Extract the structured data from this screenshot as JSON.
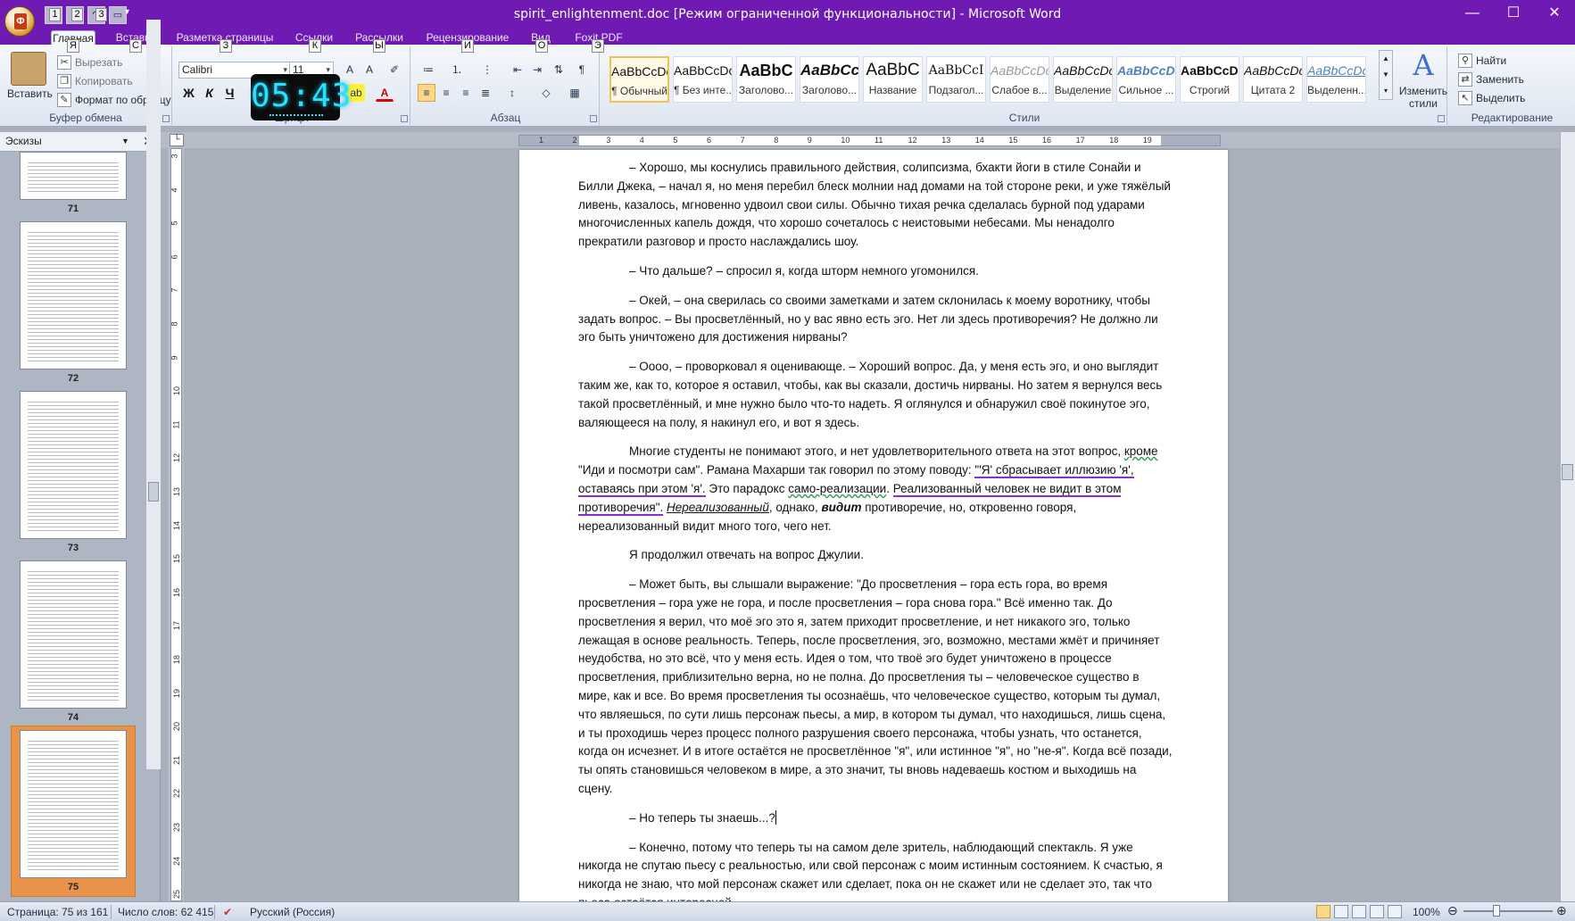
{
  "window": {
    "title": "spirit_enlightenment.doc [Режим ограниченной функциональности] - Microsoft Word",
    "office_button_letter": "Ф",
    "qat_keytips": [
      "1",
      "2",
      "3"
    ],
    "minimize": "—",
    "maximize": "☐",
    "close": "✕"
  },
  "tabs": [
    {
      "label": "Главная",
      "keytip": "Я"
    },
    {
      "label": "Вставка",
      "keytip": "С"
    },
    {
      "label": "Разметка страницы",
      "keytip": "З"
    },
    {
      "label": "Ссылки",
      "keytip": "К"
    },
    {
      "label": "Рассылки",
      "keytip": "Ы"
    },
    {
      "label": "Рецензирование",
      "keytip": "И"
    },
    {
      "label": "Вид",
      "keytip": "О"
    },
    {
      "label": "Foxit PDF",
      "keytip": "Э"
    }
  ],
  "clipboard": {
    "paste": "Вставить",
    "cut": "Вырезать",
    "copy": "Копировать",
    "format_painter": "Формат по образцу",
    "label": "Буфер обмена"
  },
  "font": {
    "name": "Calibri",
    "size": "11",
    "bold": "Ж",
    "italic": "К",
    "underline": "Ч",
    "label": "Шрифт"
  },
  "timer": "05:43",
  "paragraph": {
    "label": "Абзац"
  },
  "styles": {
    "label": "Стили",
    "change": "Изменить стили",
    "items": [
      {
        "sample": "AaBbCcDc",
        "name": "¶ Обычный"
      },
      {
        "sample": "AaBbCcDc",
        "name": "¶ Без инте..."
      },
      {
        "sample": "AaBbC",
        "name": "Заголово..."
      },
      {
        "sample": "AaBbCc",
        "name": "Заголово..."
      },
      {
        "sample": "AaBbC",
        "name": "Название"
      },
      {
        "sample": "AaBbCcI",
        "name": "Подзагол..."
      },
      {
        "sample": "AaBbCcDc",
        "name": "Слабое в..."
      },
      {
        "sample": "AaBbCcDc",
        "name": "Выделение"
      },
      {
        "sample": "AaBbCcDc",
        "name": "Сильное ..."
      },
      {
        "sample": "AaBbCcDc",
        "name": "Строгий"
      },
      {
        "sample": "AaBbCcDc",
        "name": "Цитата 2"
      },
      {
        "sample": "AaBbCcDc",
        "name": "Выделенн..."
      }
    ]
  },
  "editing": {
    "find": "Найти",
    "replace": "Заменить",
    "select": "Выделить",
    "label": "Редактирование"
  },
  "pane": {
    "title": "Эскизы",
    "pages": [
      "71",
      "72",
      "73",
      "74",
      "75"
    ]
  },
  "hruler_ticks": [
    "1",
    "2",
    "3",
    "4",
    "5",
    "6",
    "7",
    "8",
    "9",
    "10",
    "11",
    "12",
    "13",
    "14",
    "15",
    "16",
    "17",
    "18",
    "19"
  ],
  "vruler_ticks": [
    "3",
    "4",
    "5",
    "6",
    "7",
    "8",
    "9",
    "10",
    "11",
    "12",
    "13",
    "14",
    "15",
    "16",
    "17",
    "18",
    "19",
    "20",
    "21",
    "22",
    "23",
    "24",
    "25"
  ],
  "document": {
    "p1": "– Хорошо, мы коснулись правильного действия, солипсизма, бхакти йоги в стиле Сонайи и Билли Джека, – начал я, но меня перебил блеск молнии над домами на той стороне реки, и уже тяжёлый ливень, казалось, мгновенно удвоил свои силы. Обычно тихая речка сделалась бурной под ударами многочисленных капель дождя, что хорошо сочеталось с неистовыми небесами. Мы ненадолго прекратили разговор и просто наслаждались шоу.",
    "p2": "– Что дальше? – спросил я, когда шторм немного угомонился.",
    "p3": "– Окей, – она сверилась со своими заметками и затем склонилась к моему воротнику, чтобы задать вопрос. – Вы просветлённый, но у вас явно есть эго. Нет ли здесь противоречия? Не должно ли эго быть уничтожено для достижения нирваны?",
    "p4": "– Оооо, – проворковал я оценивающе. – Хороший вопрос. Да, у меня есть эго, и оно выглядит таким же, как то, которое я оставил, чтобы, как вы сказали, достичь нирваны. Но затем я вернулся весь такой просветлённый, и мне нужно было что-то надеть. Я оглянулся и обнаружил своё покинутое эго, валяющееся на полу, я накинул его, и вот я здесь.",
    "p5a": "Многие студенты не понимают этого, и нет удовлетворительного ответа на этот вопрос, ",
    "p5b": "кроме",
    "p5c": " \"Иди и посмотри сам\". Рамана Махарши так говорил по этому поводу: ",
    "p5d": "\"'Я' сбрасывает иллюзию 'я', оставаясь при этом 'я'.",
    "p5e": " Это парадокс ",
    "p5f": "само-реализации",
    "p5g": ". ",
    "p5h": "Реализованный человек не видит в этом противоречия\".",
    "p5i": " ",
    "p5j": "Нереализованный",
    "p5k": ", однако, ",
    "p5l": "видит",
    "p5m": " противоречие, но, откровенно говоря, нереализованный видит много того, чего нет.",
    "p6": "Я продолжил отвечать на вопрос Джулии.",
    "p7": "– Может быть, вы слышали выражение: \"До просветления – гора есть гора, во время просветления – гора уже не гора, и после просветления – гора снова гора.\" Всё именно так. До просветления я верил, что моё эго это я, затем приходит просветление, и нет никакого эго, только лежащая в основе реальность. Теперь, после просветления, эго, возможно, местами жмёт и причиняет неудобства, но это всё, что у меня есть. Идея о том, что твоё эго будет уничтожено в процессе просветления, приблизительно верна, но не полна. До просветления ты – человеческое существо в мире, как и все. Во время просветления ты осознаёшь, что человеческое существо, которым ты думал, что являешься, по сути лишь персонаж пьесы, а мир, в котором ты думал, что находишься, лишь сцена, и ты проходишь через процесс полного разрушения своего персонажа, чтобы узнать, что останется, когда он исчезнет. И в итоге остаётся не просветлённое \"я\", или истинное \"я\", но \"не-я\". Когда всё позади, ты опять становишься человеком в мире, а это значит, ты вновь надеваешь костюм и выходишь на сцену.",
    "p8": "– Но теперь ты знаешь...?",
    "p9": "– Конечно, потому что теперь ты на самом деле зритель, наблюдающий спектакль. Я уже никогда не спутаю пьесу с реальностью, или свой персонаж с моим истинным состоянием. К счастью, я никогда не знаю, что мой персонаж скажет или сделает, пока он не скажет или не сделает это, так что пьеса остаётся интересной."
  },
  "status": {
    "page": "Страница: 75 из 161",
    "words": "Число слов: 62 415",
    "language": "Русский (Россия)",
    "zoom": "100%"
  }
}
